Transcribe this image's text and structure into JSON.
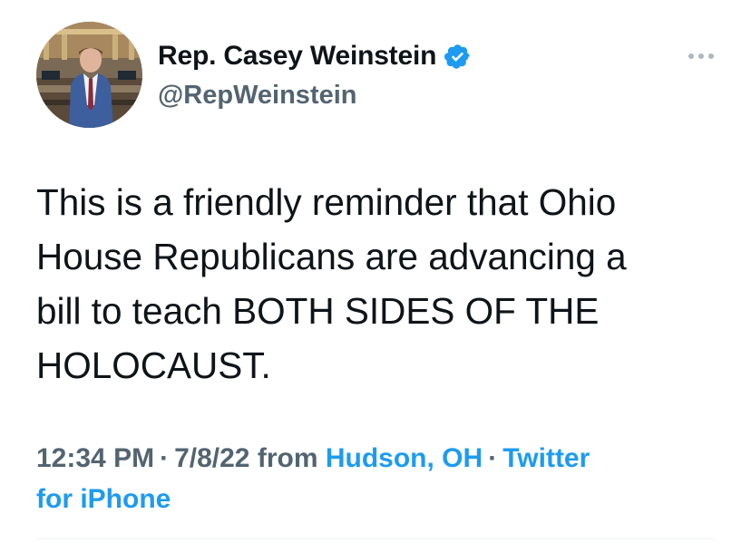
{
  "author": {
    "display_name": "Rep. Casey Weinstein",
    "handle": "@RepWeinstein",
    "verified": true,
    "avatar_icon": "profile-photo-avatar"
  },
  "icons": {
    "verified": "verified-badge-icon",
    "more": "more-options-icon"
  },
  "tweet": {
    "text": "This is a friendly reminder that Ohio\nHouse Republicans are advancing a\nbill to teach BOTH SIDES OF THE\nHOLOCAUST.",
    "time": "12:34 PM",
    "date": "7/8/22",
    "from_label": "from",
    "location": "Hudson, OH",
    "source_line1": "Twitter",
    "source_line2": "for iPhone",
    "separator": "·"
  },
  "colors": {
    "text_primary": "#0f1419",
    "text_secondary": "#536471",
    "link": "#1d9bf0",
    "verified": "#1d9bf0",
    "divider": "#eff3f4"
  }
}
